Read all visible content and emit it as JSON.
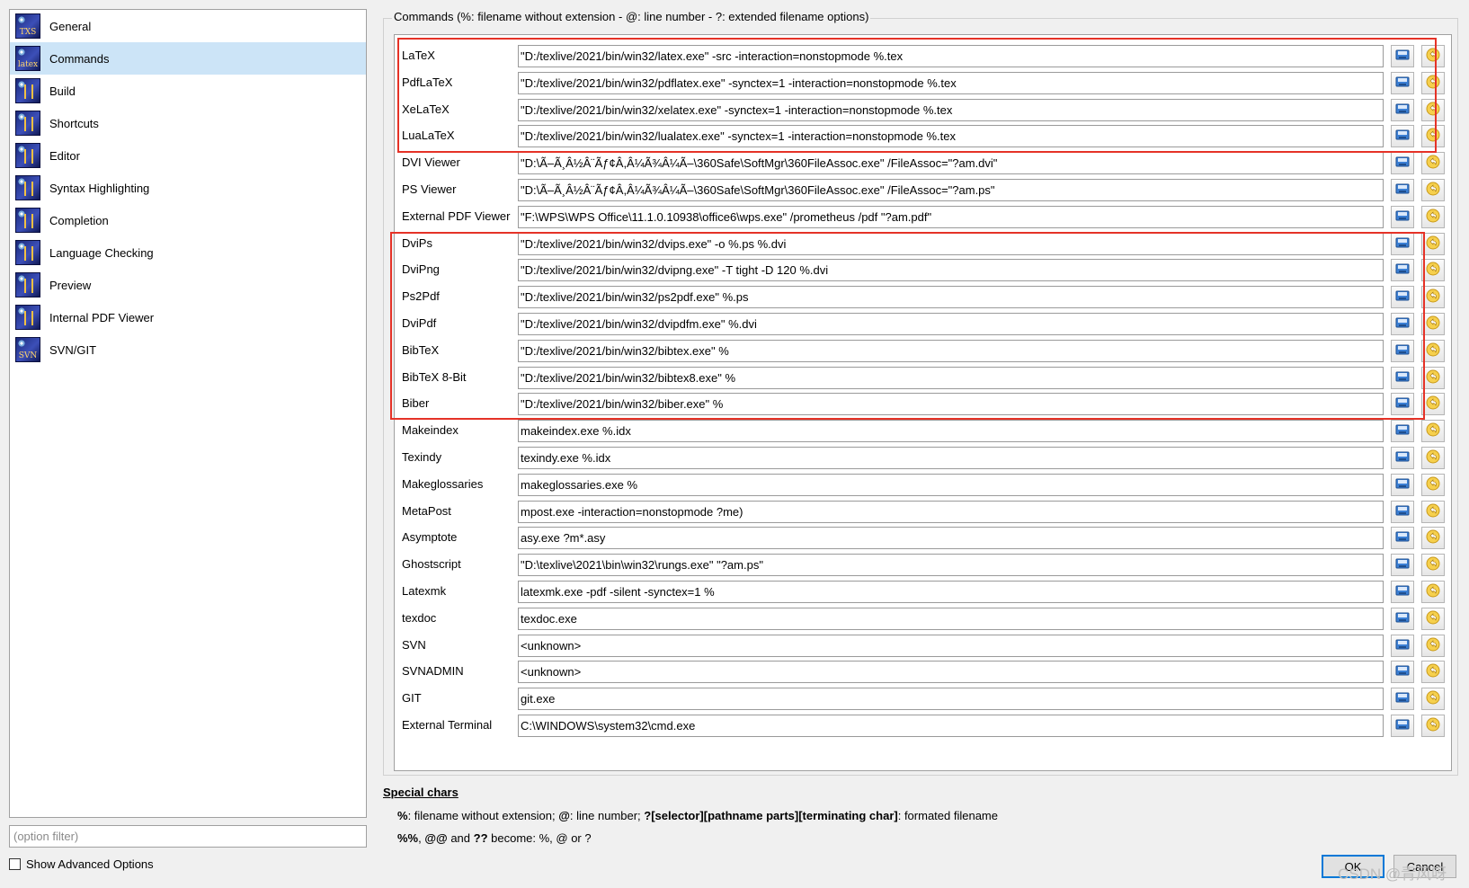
{
  "colors": {
    "selection": "#cce4f7",
    "highlight_box": "#e53227",
    "default_button_border": "#0078d7"
  },
  "sidebar": {
    "items": [
      {
        "label": "General",
        "icon": "txs-icon",
        "icon_text": "TXS"
      },
      {
        "label": "Commands",
        "icon": "latex-commands-icon",
        "icon_text": "latex",
        "selected": true
      },
      {
        "label": "Build",
        "icon": "build-icon",
        "icon_text": ""
      },
      {
        "label": "Shortcuts",
        "icon": "keyboard-icon",
        "icon_text": ""
      },
      {
        "label": "Editor",
        "icon": "editor-icon",
        "icon_text": ""
      },
      {
        "label": "Syntax Highlighting",
        "icon": "syntax-highlighting-icon",
        "icon_text": ""
      },
      {
        "label": "Completion",
        "icon": "completion-icon",
        "icon_text": ""
      },
      {
        "label": "Language Checking",
        "icon": "language-checking-icon",
        "icon_text": ""
      },
      {
        "label": "Preview",
        "icon": "preview-icon",
        "icon_text": ""
      },
      {
        "label": "Internal PDF Viewer",
        "icon": "pdf-viewer-icon",
        "icon_text": ""
      },
      {
        "label": "SVN/GIT",
        "icon": "svn-icon",
        "icon_text": "SVN"
      }
    ],
    "filter_placeholder": "(option filter)",
    "advanced_label": "Show Advanced Options"
  },
  "group_title": "Commands (%: filename without extension - @: line number - ?: extended filename options)",
  "commands": [
    {
      "label": "LaTeX",
      "value": "\"D:/texlive/2021/bin/win32/latex.exe\" -src -interaction=nonstopmode %.tex"
    },
    {
      "label": "PdfLaTeX",
      "value": "\"D:/texlive/2021/bin/win32/pdflatex.exe\" -synctex=1 -interaction=nonstopmode %.tex"
    },
    {
      "label": "XeLaTeX",
      "value": "\"D:/texlive/2021/bin/win32/xelatex.exe\" -synctex=1 -interaction=nonstopmode %.tex"
    },
    {
      "label": "LuaLaTeX",
      "value": "\"D:/texlive/2021/bin/win32/lualatex.exe\" -synctex=1 -interaction=nonstopmode %.tex"
    },
    {
      "label": "DVI Viewer",
      "value": "\"D:\\Ã–Ã¸Â½Â¨Ãƒ¢Â,Â¼Ã¾Â¼Ã–\\360Safe\\SoftMgr\\360FileAssoc.exe\" /FileAssoc=\"?am.dvi\""
    },
    {
      "label": "PS Viewer",
      "value": "\"D:\\Ã–Ã¸Â½Â¨Ãƒ¢Â,Â¼Ã¾Â¼Ã–\\360Safe\\SoftMgr\\360FileAssoc.exe\" /FileAssoc=\"?am.ps\""
    },
    {
      "label": "External PDF Viewer",
      "value": "\"F:\\WPS\\WPS Office\\11.1.0.10938\\office6\\wps.exe\" /prometheus /pdf \"?am.pdf\""
    },
    {
      "label": "DviPs",
      "value": "\"D:/texlive/2021/bin/win32/dvips.exe\" -o %.ps %.dvi"
    },
    {
      "label": "DviPng",
      "value": "\"D:/texlive/2021/bin/win32/dvipng.exe\" -T tight -D 120 %.dvi"
    },
    {
      "label": "Ps2Pdf",
      "value": "\"D:/texlive/2021/bin/win32/ps2pdf.exe\" %.ps"
    },
    {
      "label": "DviPdf",
      "value": "\"D:/texlive/2021/bin/win32/dvipdfm.exe\" %.dvi"
    },
    {
      "label": "BibTeX",
      "value": "\"D:/texlive/2021/bin/win32/bibtex.exe\" %"
    },
    {
      "label": "BibTeX 8-Bit",
      "value": "\"D:/texlive/2021/bin/win32/bibtex8.exe\" %"
    },
    {
      "label": "Biber",
      "value": "\"D:/texlive/2021/bin/win32/biber.exe\" %"
    },
    {
      "label": "Makeindex",
      "value": "makeindex.exe %.idx"
    },
    {
      "label": "Texindy",
      "value": "texindy.exe %.idx"
    },
    {
      "label": "Makeglossaries",
      "value": "makeglossaries.exe %"
    },
    {
      "label": "MetaPost",
      "value": "mpost.exe -interaction=nonstopmode ?me)"
    },
    {
      "label": "Asymptote",
      "value": "asy.exe ?m*.asy"
    },
    {
      "label": "Ghostscript",
      "value": "\"D:\\texlive\\2021\\bin\\win32\\rungs.exe\" \"?am.ps\""
    },
    {
      "label": "Latexmk",
      "value": "latexmk.exe -pdf -silent -synctex=1 %"
    },
    {
      "label": "texdoc",
      "value": "texdoc.exe"
    },
    {
      "label": "SVN",
      "value": "<unknown>"
    },
    {
      "label": "SVNADMIN",
      "value": "<unknown>"
    },
    {
      "label": "GIT",
      "value": "git.exe"
    },
    {
      "label": "External Terminal",
      "value": "C:\\WINDOWS\\system32\\cmd.exe"
    }
  ],
  "special": {
    "title": "Special chars",
    "line1": {
      "a": "%",
      "b": ": filename without extension; ",
      "c": "@",
      "d": ": line number; ",
      "e": "?[selector][pathname parts][terminating char]",
      "f": ": formated filename"
    },
    "line2": {
      "a": "%%",
      "b": ", ",
      "c": "@@",
      "d": " and ",
      "e": "??",
      "f": " become: %, @ or ?"
    }
  },
  "buttons": {
    "ok": "OK",
    "cancel": "Cancel"
  },
  "watermark": "CSDN @青风呀"
}
